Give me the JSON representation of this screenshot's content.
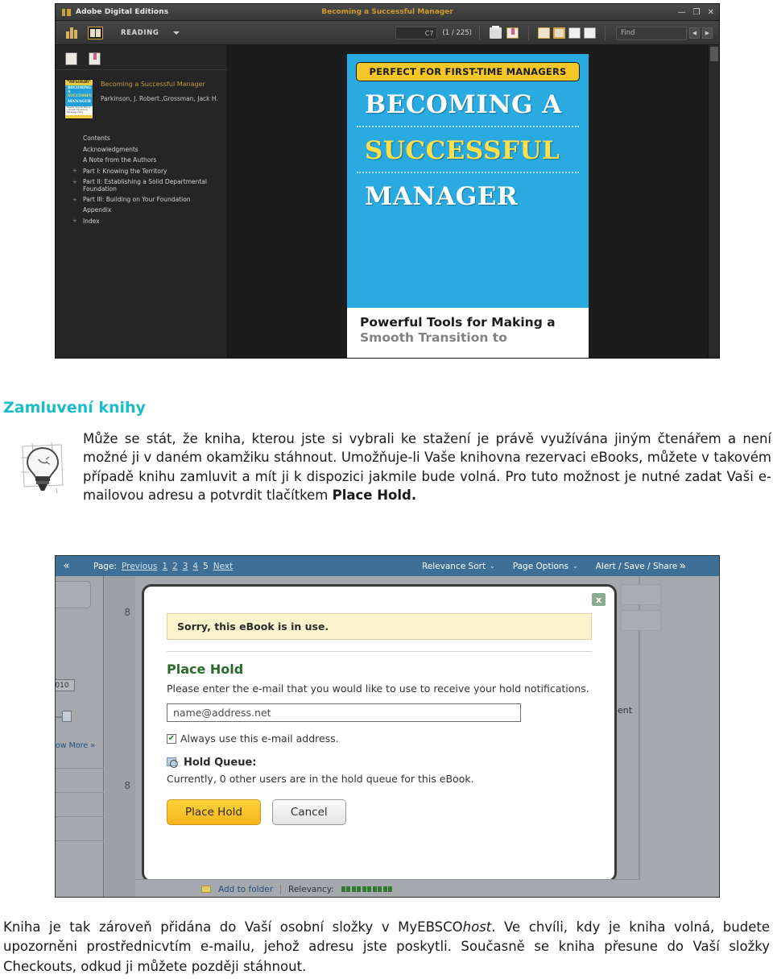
{
  "ade": {
    "app_title": "Adobe Digital Editions",
    "document_title": "Becoming a Successful Manager",
    "window_buttons": {
      "minimize": "—",
      "maximize": "❐",
      "close": "✕"
    },
    "toolbar": {
      "mode_label": "READING",
      "page_field_value": "C7",
      "page_count": "(1 / 225)",
      "find_placeholder": "Find",
      "prev_arrow": "◀",
      "next_arrow": "▶"
    },
    "sidebar": {
      "book_title": "Becoming a Successful Manager",
      "book_author": "Parkinson, J. Robert.,Grossman, Jack H.",
      "cover": {
        "band": "PERFECT FOR FIRST-TIME MANAGERS",
        "line1": "BECOMING A",
        "line2": "SUCCESSFUL",
        "line3": "MANAGER",
        "footer": "Powerful Tools for Making a Smooth Transition to Managing a Team"
      },
      "toc": [
        {
          "label": "Contents",
          "expandable": false
        },
        {
          "label": "Acknowledgments",
          "expandable": false
        },
        {
          "label": "A Note from the Authors",
          "expandable": false
        },
        {
          "label": "Part I: Knowing the Territory",
          "expandable": true
        },
        {
          "label": "Part II: Establishing a Solid Departmental Foundation",
          "expandable": true
        },
        {
          "label": "Part III: Building on Your Foundation",
          "expandable": true
        },
        {
          "label": "Appendix",
          "expandable": false
        },
        {
          "label": "Index",
          "expandable": true
        }
      ]
    },
    "page": {
      "band": "PERFECT FOR FIRST-TIME MANAGERS",
      "title_line1": "BECOMING A",
      "title_line2": "SUCCESSFUL",
      "title_line3": "MANAGER",
      "subtitle_line1": "Powerful Tools for Making a",
      "subtitle_line2": "Smooth Transition to"
    }
  },
  "article": {
    "heading": "Zamluvení knihy",
    "paragraph1_part1": "Může se stát, že kniha, kterou jste si vybrali ke stažení je právě využívána jiným čtenářem a není možné ji v daném okamžiku stáhnout. Umožňuje-li Vaše knihovna rezervaci eBooks, můžete v takovém případě knihu zamluvit a mít ji k dispozici jakmile bude volná. Pro tuto možnost je nutné zadat Vaši e-mailovou adresu a potvrdit tlačítkem ",
    "paragraph1_bold": "Place Hold.",
    "paragraph2_part1": "Kniha je tak zároveň přidána do Vaší osobní složky v MyEBSCO",
    "paragraph2_italic": "host",
    "paragraph2_part2": ". Ve chvíli, kdy je kniha volná, budete upozorněni prostřednicvtím e-mailu, jehož adresu jste poskytli. Současně se kniha přesune do Vaší složky Checkouts, odkud ji můžete později stáhnout."
  },
  "ebsco": {
    "topbar": {
      "collapse_left": "«",
      "collapse_right": "»",
      "page_label": "Page:",
      "previous": "Previous",
      "pages": [
        "1",
        "2",
        "3",
        "4",
        "5"
      ],
      "current_page": "5",
      "next": "Next",
      "menus": [
        "Relevance Sort",
        "Page Options",
        "Alert / Save / Share"
      ],
      "menu_caret": "⌄"
    },
    "left_panel": {
      "year_value": "010",
      "show_more": "how More »"
    },
    "result_numbers": [
      "8",
      "8"
    ],
    "right_panel": {
      "text_fragment": "ent"
    },
    "dialog": {
      "close_label": "x",
      "alert": "Sorry, this eBook is in use.",
      "heading": "Place Hold",
      "description": "Please enter the e-mail that you would like to use to receive your hold notifications.",
      "email_value": "name@address.net",
      "checkbox_checked": "✔",
      "checkbox_label": "Always use this e-mail address.",
      "queue_heading": "Hold Queue:",
      "queue_text": "Currently, 0 other users are in the hold queue for this eBook.",
      "primary_button": "Place Hold",
      "secondary_button": "Cancel"
    },
    "bottom_bar": {
      "add_to_folder": "Add to folder",
      "relevancy_label": "Relevancy:",
      "relevancy_bars": 10
    }
  },
  "colors": {
    "heading_teal": "#19bcc8",
    "ade_gold": "#d09a30",
    "cover_blue": "#29abe2",
    "cover_yellow": "#f4c728",
    "ebsco_blue": "#3e6f96",
    "place_hold_green": "#2a6b2c",
    "button_yellow": "#f4b51a"
  }
}
